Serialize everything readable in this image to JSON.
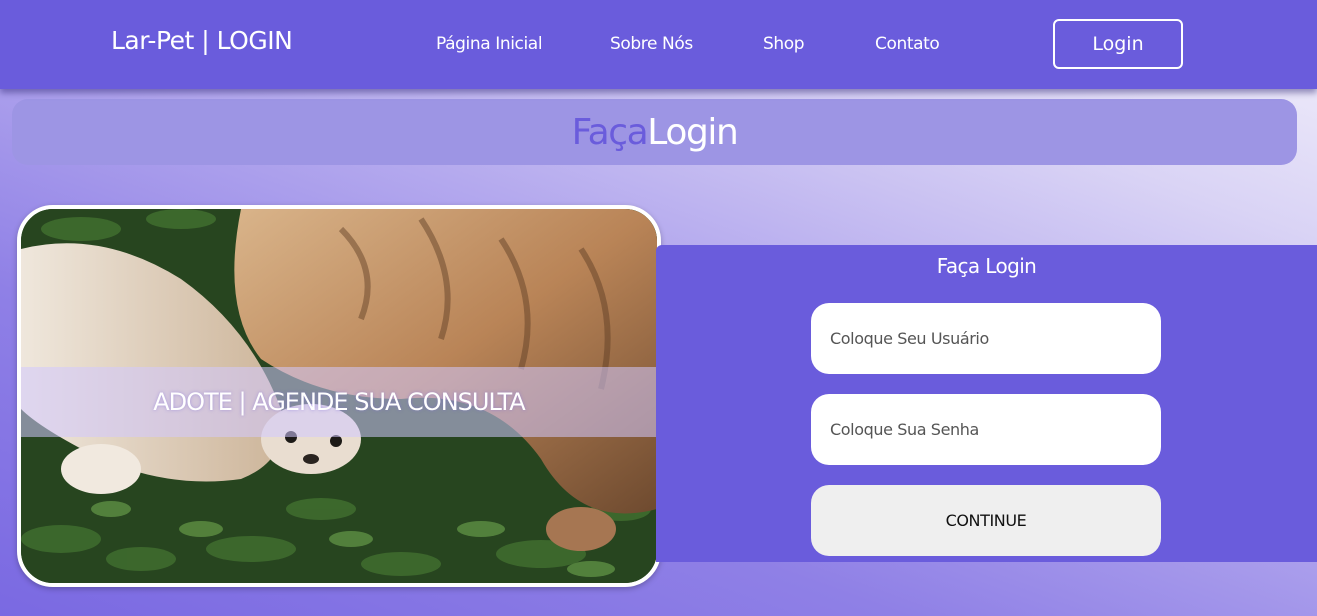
{
  "navbar": {
    "brand": "Lar-Pet | LOGIN",
    "links": [
      "Página Inicial",
      "Sobre Nós",
      "Shop",
      "Contato"
    ],
    "login_button": "Login"
  },
  "banner": {
    "title_part1": "Faça",
    "title_part2": "Login"
  },
  "image_card": {
    "overlay_text": "ADOTE | AGENDE SUA CONSULTA"
  },
  "login_form": {
    "title": "Faça Login",
    "username_placeholder": "Coloque Seu Usuário",
    "password_placeholder": "Coloque Sua Senha",
    "submit_label": "CONTINUE"
  },
  "colors": {
    "primary": "#6a5cdc",
    "banner": "#9d95e4",
    "button_bg": "#efefef"
  }
}
